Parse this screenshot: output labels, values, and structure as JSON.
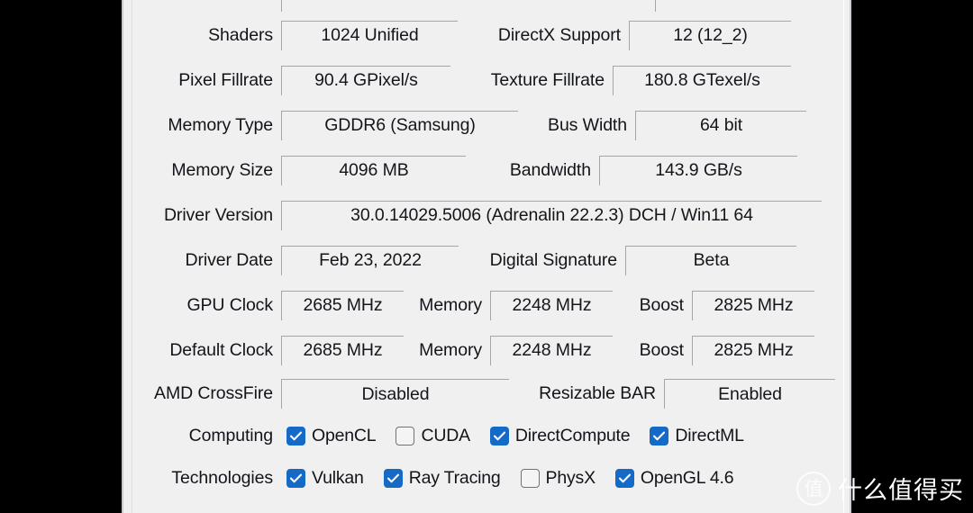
{
  "app": {
    "name": "GPU-Z Graphics Card tab"
  },
  "rows": [
    {
      "id": "shaders",
      "left_label": "Shaders",
      "left_value": "1024 Unified",
      "right_label": "DirectX Support",
      "right_value": "12 (12_2)"
    },
    {
      "id": "fillrate",
      "left_label": "Pixel Fillrate",
      "left_value": "90.4 GPixel/s",
      "right_label": "Texture Fillrate",
      "right_value": "180.8 GTexel/s"
    },
    {
      "id": "memory-type",
      "left_label": "Memory Type",
      "left_value": "GDDR6 (Samsung)",
      "right_label": "Bus Width",
      "right_value": "64 bit"
    },
    {
      "id": "memory-size",
      "left_label": "Memory Size",
      "left_value": "4096 MB",
      "right_label": "Bandwidth",
      "right_value": "143.9 GB/s"
    },
    {
      "id": "driver-version",
      "left_label": "Driver Version",
      "left_value": "30.0.14029.5006 (Adrenalin 22.2.3) DCH / Win11 64"
    },
    {
      "id": "driver-date",
      "left_label": "Driver Date",
      "left_value": "Feb 23, 2022",
      "right_label": "Digital Signature",
      "right_value": "Beta"
    },
    {
      "id": "gpu-clock",
      "left_label": "GPU Clock",
      "left_value": "2685 MHz",
      "mid_label": "Memory",
      "mid_value": "2248 MHz",
      "right_label": "Boost",
      "right_value": "2825 MHz"
    },
    {
      "id": "default-clock",
      "left_label": "Default Clock",
      "left_value": "2685 MHz",
      "mid_label": "Memory",
      "mid_value": "2248 MHz",
      "right_label": "Boost",
      "right_value": "2825 MHz"
    },
    {
      "id": "crossfire",
      "left_label": "AMD CrossFire",
      "left_value": "Disabled",
      "right_label": "Resizable BAR",
      "right_value": "Enabled"
    }
  ],
  "computing": {
    "label": "Computing",
    "items": [
      {
        "label": "OpenCL",
        "checked": true
      },
      {
        "label": "CUDA",
        "checked": false
      },
      {
        "label": "DirectCompute",
        "checked": true
      },
      {
        "label": "DirectML",
        "checked": true
      }
    ]
  },
  "technologies": {
    "label": "Technologies",
    "items": [
      {
        "label": "Vulkan",
        "checked": true
      },
      {
        "label": "Ray Tracing",
        "checked": true
      },
      {
        "label": "PhysX",
        "checked": false
      },
      {
        "label": "OpenGL 4.6",
        "checked": true
      }
    ]
  },
  "watermark": {
    "logo_glyph": "值",
    "text": "什么值得买"
  },
  "colors": {
    "panel_background": "#f0f0f0",
    "field_border": "#a6a6a6",
    "checkbox_checked": "#1569c7",
    "checkbox_unchecked_border": "#6e7378",
    "text": "#12141a",
    "letterbox": "#000000"
  }
}
